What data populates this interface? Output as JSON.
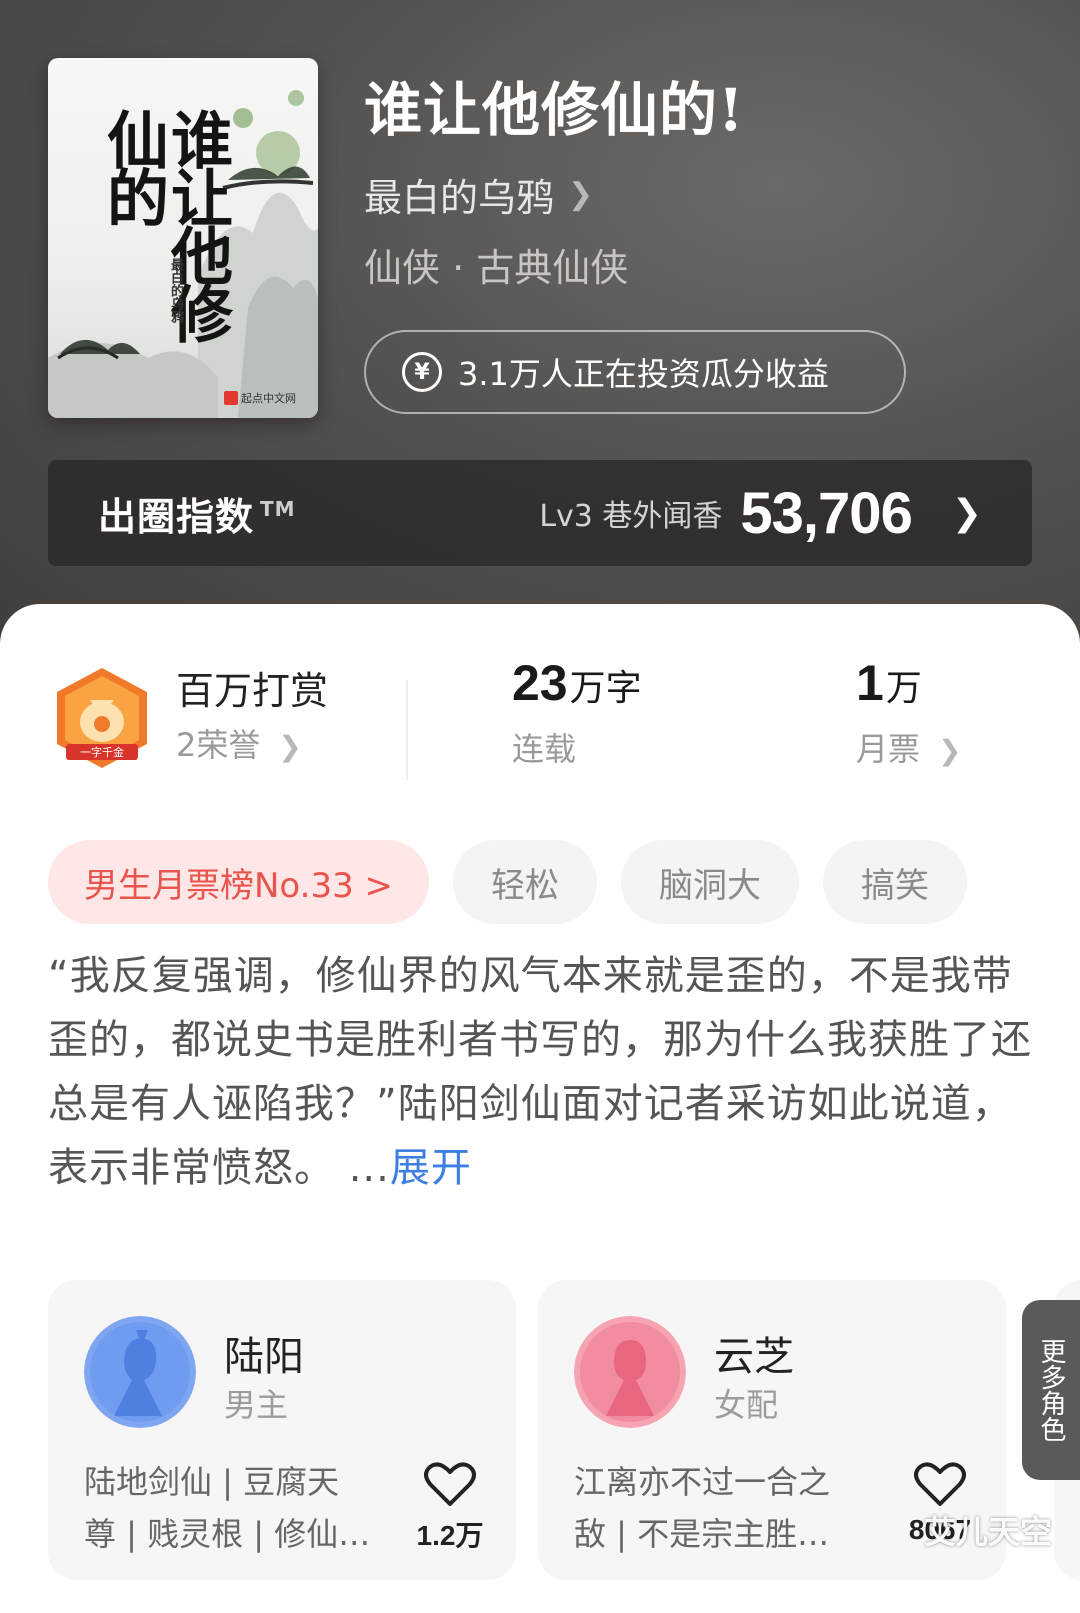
{
  "book": {
    "cover": {
      "title": "谁让他修仙的",
      "author": "最白的乌鸦",
      "publisher": "起点中文网"
    },
    "title": "谁让他修仙的!",
    "author": "最白的乌鸦",
    "genre": "仙侠 · 古典仙侠",
    "invest_text": "3.1万人正在投资瓜分收益"
  },
  "index": {
    "title": "出圈指数",
    "tm": "TM",
    "level": "Lv3 巷外闻香",
    "value": "53,706"
  },
  "stats": {
    "reward": {
      "title": "百万打赏",
      "sub": "2荣誉",
      "medal_text": "一字千金"
    },
    "words": {
      "num": "23",
      "unit": "万字",
      "sub": "连载"
    },
    "votes": {
      "num": "1",
      "unit": "万",
      "sub": "月票"
    }
  },
  "tags": {
    "rank": "男生月票榜No.33 >",
    "items": [
      "轻松",
      "脑洞大",
      "搞笑"
    ]
  },
  "synopsis": {
    "text": "“我反复强调，修仙界的风气本来就是歪的，不是我带歪的，都说史书是胜利者书写的，那为什么我获胜了还总是有人诬陷我？”陆阳剑仙面对记者采访如此说道，表示非常愤怒。 ...",
    "expand": "展开"
  },
  "characters": [
    {
      "name": "陆阳",
      "role": "男主",
      "desc_line1": "陆地剑仙 | 豆腐天",
      "desc_line2": "尊 | 贱灵根 | 修仙…",
      "likes": "1.2万",
      "avatar_color": "#6f9cf0"
    },
    {
      "name": "云芝",
      "role": "女配",
      "desc_line1": "江离亦不过一合之",
      "desc_line2": "敌 | 不是宗主胜…",
      "likes": "8067",
      "avatar_color": "#f28ca0"
    }
  ],
  "more_roles": "更多角色",
  "watermark": "艾儿天空"
}
